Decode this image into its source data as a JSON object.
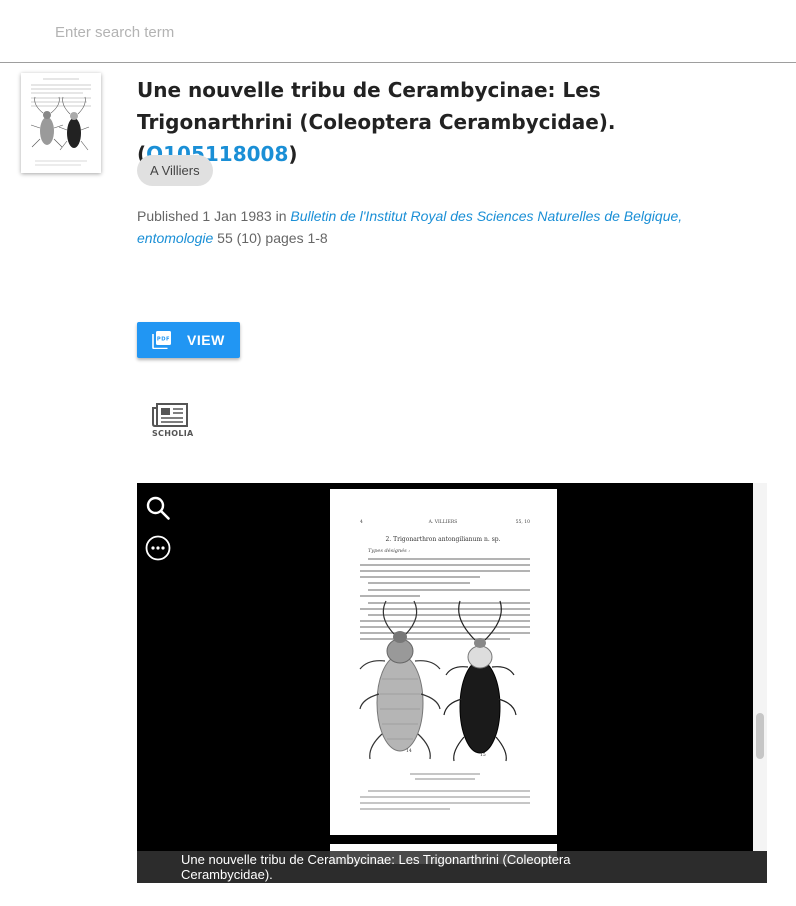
{
  "search": {
    "placeholder": "Enter search term",
    "value": ""
  },
  "article": {
    "title_main": "Une nouvelle tribu de Cerambycinae: Les Trigonarthrini (Coleoptera Cerambycidae). (",
    "wikidata_id": "Q105118008",
    "title_close": ")",
    "author": "A Villiers",
    "published_prefix": "Published ",
    "date": "1 Jan 1983",
    "in_word": " in ",
    "journal": "Bulletin de l'Institut Royal des Sciences Naturelles de Belgique, entomologie",
    "volume_issue": " 55 (10) pages 1-8"
  },
  "actions": {
    "view_label": "VIEW",
    "pdf_icon": "pdf-icon",
    "scholia_label": "SCHOLIA",
    "scholia_icon": "scholia-icon"
  },
  "viewer": {
    "caption": "Une nouvelle tribu de Cerambycinae: Les Trigonarthrini (Coleoptera Cerambycidae).",
    "zoom_icon": "search-icon",
    "more_icon": "more-options-icon",
    "page": {
      "header_left": "4",
      "header_center": "A. VILLIERS",
      "header_right": "55, 10",
      "heading": "2. Trigonarthron antongilianum n. sp.",
      "types_label": "Types désignés :",
      "label_left": "14",
      "label_right": "15"
    }
  }
}
